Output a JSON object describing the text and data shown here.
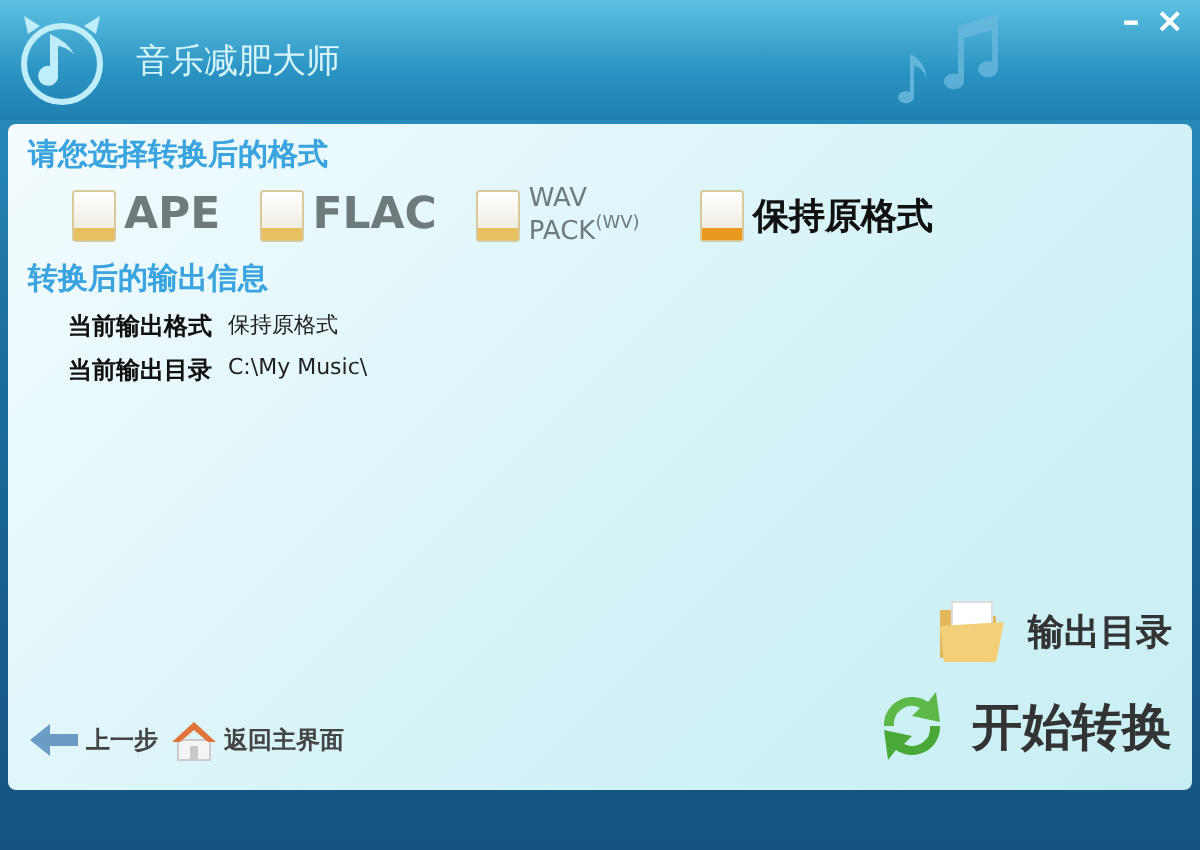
{
  "window": {
    "title": "音乐减肥大师",
    "controls": [
      "–",
      "×"
    ]
  },
  "format_section": {
    "heading": "请您选择转换后的格式",
    "formats": [
      {
        "label": "APE",
        "selected": false
      },
      {
        "label": "FLAC",
        "selected": false
      },
      {
        "label": "WAV PACK$^{(WV)}$",
        "selected": false,
        "kind": "stacked"
      },
      {
        "label": "保持原格式",
        "selected": true
      }
    ]
  },
  "output_section": {
    "heading": "转换后的输出信息",
    "rows": [
      {
        "label": "当前输出格式",
        "value": "保持原格式"
      },
      {
        "label": "当前输出目录",
        "value": "C:\\My Music\\"
      }
    ]
  },
  "actions": [
    {
      "label": "输出目录",
      "kind": "folder"
    },
    {
      "label": "开始转换",
      "kind": "convert"
    }
  ],
  "nav": [
    {
      "label": "上一步",
      "kind": "back"
    },
    {
      "label": "返回主界面",
      "kind": "home"
    }
  ]
}
